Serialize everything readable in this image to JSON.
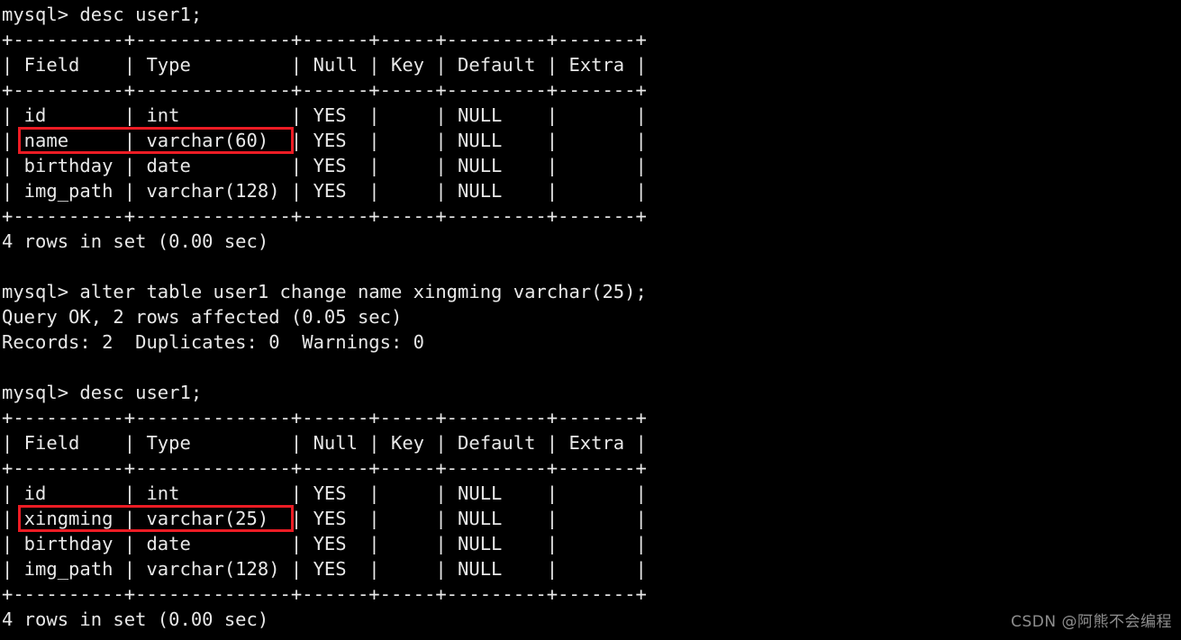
{
  "terminal": {
    "prompt": "mysql> ",
    "foreground_color": "#e8e8e8",
    "background_color": "#000000",
    "highlight_color": "#ec1c24",
    "lines": [
      "mysql> desc user1;",
      "+----------+--------------+------+-----+---------+-------+",
      "| Field    | Type         | Null | Key | Default | Extra |",
      "+----------+--------------+------+-----+---------+-------+",
      "| id       | int          | YES  |     | NULL    |       |",
      "| name     | varchar(60)  | YES  |     | NULL    |       |",
      "| birthday | date         | YES  |     | NULL    |       |",
      "| img_path | varchar(128) | YES  |     | NULL    |       |",
      "+----------+--------------+------+-----+---------+-------+",
      "4 rows in set (0.00 sec)",
      "",
      "mysql> alter table user1 change name xingming varchar(25);",
      "Query OK, 2 rows affected (0.05 sec)",
      "Records: 2  Duplicates: 0  Warnings: 0",
      "",
      "mysql> desc user1;",
      "+----------+--------------+------+-----+---------+-------+",
      "| Field    | Type         | Null | Key | Default | Extra |",
      "+----------+--------------+------+-----+---------+-------+",
      "| id       | int          | YES  |     | NULL    |       |",
      "| xingming | varchar(25)  | YES  |     | NULL    |       |",
      "| birthday | date         | YES  |     | NULL    |       |",
      "| img_path | varchar(128) | YES  |     | NULL    |       |",
      "+----------+--------------+------+-----+---------+-------+",
      "4 rows in set (0.00 sec)"
    ]
  },
  "commands": [
    {
      "index": 0,
      "text": "desc user1;",
      "full_line": "mysql> desc user1;"
    },
    {
      "index": 1,
      "text": "alter table user1 change name xingming varchar(25);",
      "full_line": "mysql> alter table user1 change name xingming varchar(25);"
    },
    {
      "index": 2,
      "text": "desc user1;",
      "full_line": "mysql> desc user1;"
    }
  ],
  "results": {
    "first_desc": {
      "columns": [
        "Field",
        "Type",
        "Null",
        "Key",
        "Default",
        "Extra"
      ],
      "rows": [
        [
          "id",
          "int",
          "YES",
          "",
          "NULL",
          ""
        ],
        [
          "name",
          "varchar(60)",
          "YES",
          "",
          "NULL",
          ""
        ],
        [
          "birthday",
          "date",
          "YES",
          "",
          "NULL",
          ""
        ],
        [
          "img_path",
          "varchar(128)",
          "YES",
          "",
          "NULL",
          ""
        ]
      ],
      "footer": "4 rows in set (0.00 sec)",
      "highlighted_row": "name"
    },
    "alter_output": {
      "line1": "Query OK, 2 rows affected (0.05 sec)",
      "line2": "Records: 2  Duplicates: 0  Warnings: 0"
    },
    "second_desc": {
      "columns": [
        "Field",
        "Type",
        "Null",
        "Key",
        "Default",
        "Extra"
      ],
      "rows": [
        [
          "id",
          "int",
          "YES",
          "",
          "NULL",
          ""
        ],
        [
          "xingming",
          "varchar(25)",
          "YES",
          "",
          "NULL",
          ""
        ],
        [
          "birthday",
          "date",
          "YES",
          "",
          "NULL",
          ""
        ],
        [
          "img_path",
          "varchar(128)",
          "YES",
          "",
          "NULL",
          ""
        ]
      ],
      "footer": "4 rows in set (0.00 sec)",
      "highlighted_row": "xingming"
    }
  },
  "watermark": {
    "text": "CSDN @阿熊不会编程"
  }
}
